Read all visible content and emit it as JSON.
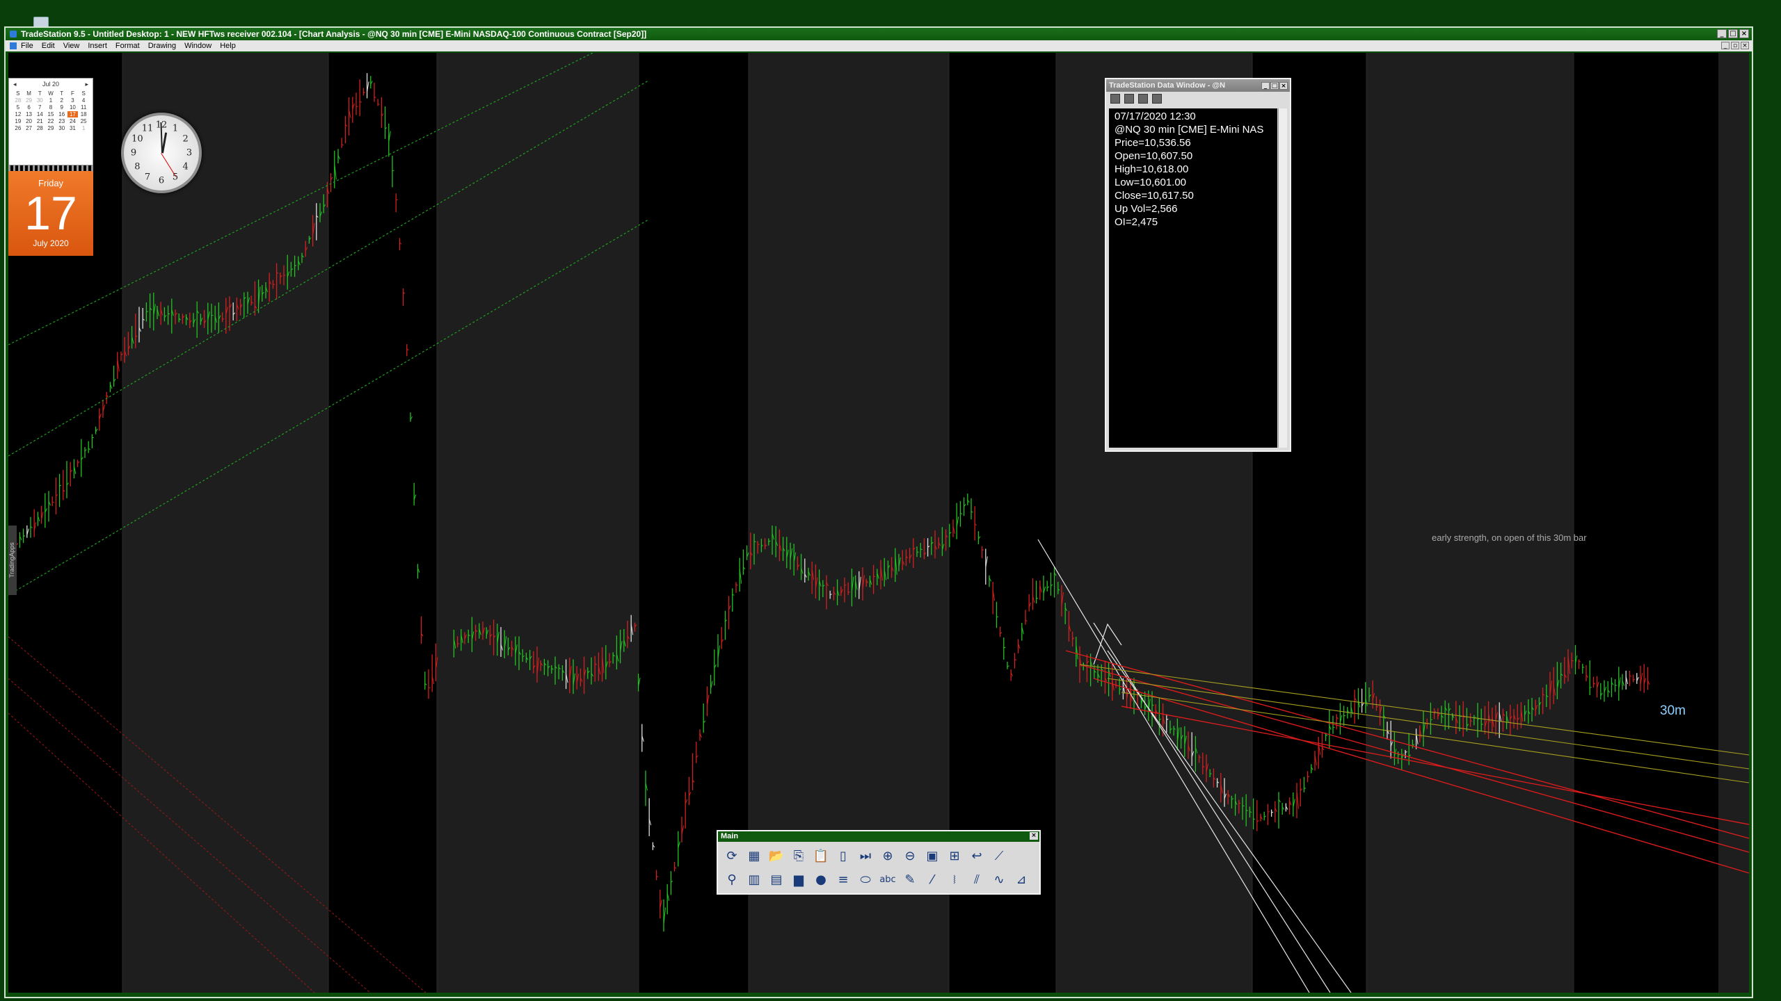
{
  "window": {
    "title": "TradeStation 9.5 - Untitled Desktop: 1 - NEW HFTws receiver 002.104 - [Chart Analysis - @NQ 30 min [CME] E-Mini NASDAQ-100 Continuous Contract [Sep20]]"
  },
  "menu": [
    "File",
    "Edit",
    "View",
    "Insert",
    "Format",
    "Drawing",
    "Window",
    "Help"
  ],
  "calendar": {
    "month_label": "Jul 20",
    "weekdays": [
      "S",
      "M",
      "T",
      "W",
      "T",
      "F",
      "S"
    ],
    "days": [
      "28",
      "29",
      "30",
      "1",
      "2",
      "3",
      "4",
      "5",
      "6",
      "7",
      "8",
      "9",
      "10",
      "11",
      "12",
      "13",
      "14",
      "15",
      "16",
      "17",
      "18",
      "19",
      "20",
      "21",
      "22",
      "23",
      "24",
      "25",
      "26",
      "27",
      "28",
      "29",
      "30",
      "31",
      "1"
    ],
    "weekday_name": "Friday",
    "day": "17",
    "month_year": "July 2020"
  },
  "clock": {
    "numbers": [
      "12",
      "1",
      "2",
      "3",
      "4",
      "5",
      "6",
      "7",
      "8",
      "9",
      "10",
      "11"
    ]
  },
  "side_tab": "TradingApps",
  "data_window": {
    "title": "TradeStation Data Window - @N",
    "lines": [
      "07/17/2020 12:30",
      "@NQ 30 min [CME] E-Mini NAS",
      "Price=10,536.56",
      "Open=10,607.50",
      "High=10,618.00",
      "Low=10,601.00",
      "Close=10,617.50",
      "Up Vol=2,566",
      "OI=2,475"
    ]
  },
  "annotation": "early strength, on open of this 30m bar",
  "timeframe_label": "30m",
  "main_toolbar": {
    "title": "Main",
    "row1": [
      "refresh-icon",
      "chart-window-icon",
      "open-icon",
      "copy-icon",
      "paste-icon",
      "new-page-icon",
      "skip-end-icon",
      "zoom-in-icon",
      "zoom-out-icon",
      "chart-style-icon",
      "layout-icon",
      "curve-icon",
      "trendline-icon"
    ],
    "row2": [
      "indicator-icon",
      "bars-icon",
      "window-icon",
      "color-icon",
      "dots-icon",
      "lines-icon",
      "ellipse-icon",
      "text-icon",
      "pencil-icon",
      "draw-icon",
      "fib-icon",
      "channel-icon",
      "wave-icon",
      "magnet-icon"
    ],
    "text_button": "abc"
  },
  "colors": {
    "up_bar": "#22c322",
    "down_bar": "#d42020",
    "neutral_bar": "#e0e0e0",
    "session_shade": "#1e1e1e",
    "bg": "#000000"
  }
}
